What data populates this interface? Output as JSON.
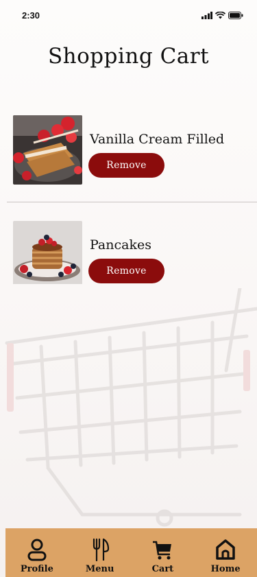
{
  "status_bar": {
    "time": "2:30"
  },
  "page": {
    "title": "Shopping Cart"
  },
  "cart": {
    "items": [
      {
        "name": "Vanilla Cream Filled",
        "remove_label": "Remove",
        "image": "french-toast-strawberries"
      },
      {
        "name": "Pancakes",
        "remove_label": "Remove",
        "image": "pancakes-berries"
      }
    ]
  },
  "tabs": [
    {
      "label": "Profile",
      "icon": "profile-icon"
    },
    {
      "label": "Menu",
      "icon": "fork-knife-icon"
    },
    {
      "label": "Cart",
      "icon": "cart-icon"
    },
    {
      "label": "Home",
      "icon": "home-icon"
    }
  ],
  "colors": {
    "accent": "#8b0c0c",
    "tab_bar": "#dca365",
    "background": "#fbf9f8"
  }
}
